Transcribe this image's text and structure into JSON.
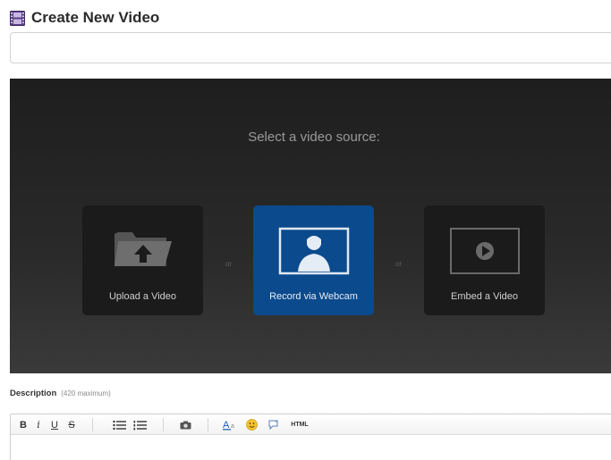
{
  "header": {
    "title": "Create New Video",
    "icon": "film-icon"
  },
  "title_input": {
    "value": "",
    "placeholder": ""
  },
  "source_panel": {
    "prompt": "Select a video source:",
    "separator": "or",
    "options": [
      {
        "label": "Upload a Video",
        "icon": "folder-upload-icon",
        "selected": false
      },
      {
        "label": "Record via Webcam",
        "icon": "webcam-person-icon",
        "selected": true
      },
      {
        "label": "Embed a Video",
        "icon": "embed-play-icon",
        "selected": false
      }
    ],
    "colors": {
      "panel": "#262626",
      "tile": "#1b1b1b",
      "selected_tile": "#0b4a8c"
    }
  },
  "description": {
    "label": "Description",
    "hint": "(420 maximum)"
  },
  "editor_toolbar": {
    "bold": "B",
    "italic": "i",
    "underline": "U",
    "strike": "S",
    "html": "HTML"
  }
}
